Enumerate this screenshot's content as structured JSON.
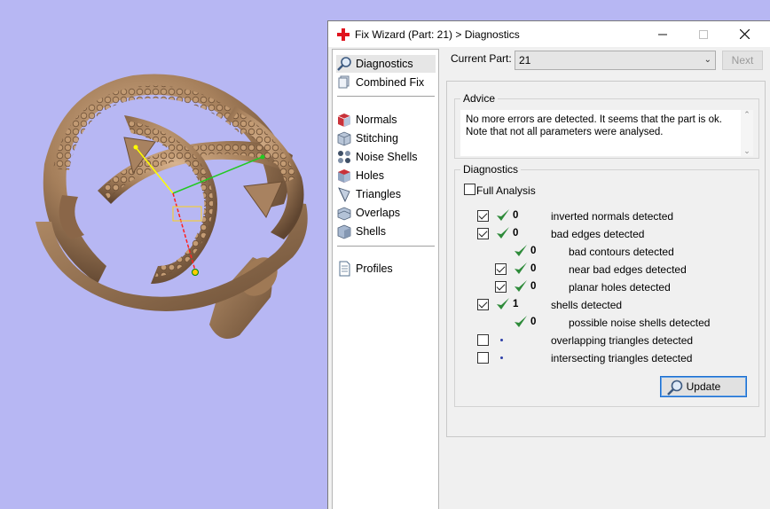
{
  "window": {
    "title": "Fix Wizard (Part: 21) > Diagnostics",
    "minimize_glyph": "—",
    "maximize_glyph": "☐",
    "close_glyph": "✕"
  },
  "sidebar": {
    "items": [
      {
        "label": "Diagnostics",
        "icon": "magnifier-icon"
      },
      {
        "label": "Combined Fix",
        "icon": "combined-fix-icon"
      },
      {
        "label": "Normals",
        "icon": "normals-cube-icon"
      },
      {
        "label": "Stitching",
        "icon": "stitching-icon"
      },
      {
        "label": "Noise Shells",
        "icon": "noise-shells-icon"
      },
      {
        "label": "Holes",
        "icon": "holes-icon"
      },
      {
        "label": "Triangles",
        "icon": "triangles-icon"
      },
      {
        "label": "Overlaps",
        "icon": "overlaps-icon"
      },
      {
        "label": "Shells",
        "icon": "shells-icon"
      },
      {
        "label": "Profiles",
        "icon": "profiles-document-icon"
      }
    ]
  },
  "part": {
    "label": "Current Part:",
    "value": "21",
    "next_label": "Next"
  },
  "advice": {
    "title": "Advice",
    "line1": "No more errors are detected. It seems that the part is ok.",
    "line2": "Note that not all parameters were analysed."
  },
  "diagnostics": {
    "title": "Diagnostics",
    "full_analysis_label": "Full Analysis",
    "rows": [
      {
        "count": "0",
        "label": "inverted normals detected"
      },
      {
        "count": "0",
        "label": "bad edges detected"
      },
      {
        "count": "0",
        "label": "bad contours detected"
      },
      {
        "count": "0",
        "label": "near bad edges detected"
      },
      {
        "count": "0",
        "label": "planar holes detected"
      },
      {
        "count": "1",
        "label": "shells detected"
      },
      {
        "count": "0",
        "label": "possible noise shells detected"
      },
      {
        "count": "",
        "label": "overlapping triangles detected"
      },
      {
        "count": "",
        "label": "intersecting triangles detected"
      }
    ],
    "update_label": "Update"
  },
  "colors": {
    "viewport_bg": "#b7b7f3",
    "ring_gold": "#a07c5a",
    "check_green": "#2e8b3a"
  }
}
